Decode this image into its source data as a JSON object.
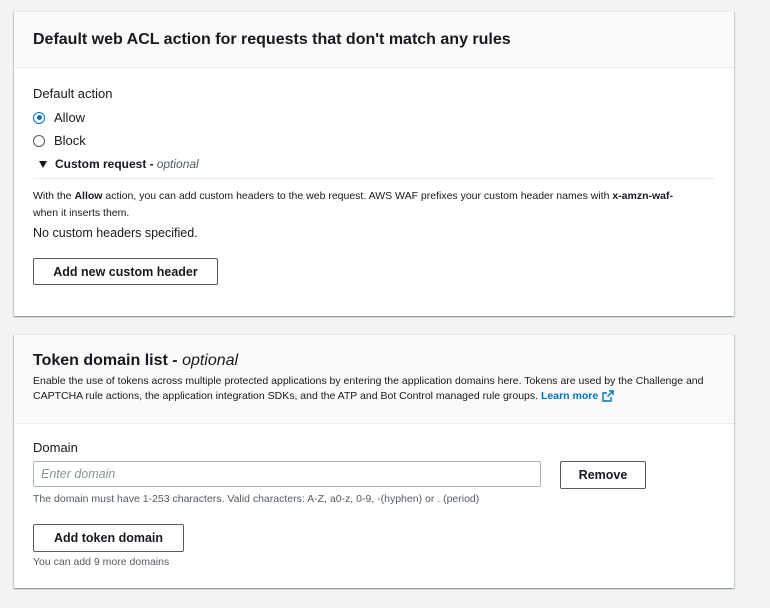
{
  "default_action_section": {
    "title": "Default web ACL action for requests that don't match any rules",
    "field_label": "Default action",
    "options": [
      {
        "label": "Allow",
        "checked": true
      },
      {
        "label": "Block",
        "checked": false
      }
    ],
    "custom_request": {
      "label": "Custom request -",
      "optional": "optional",
      "desc_prefix": "With the ",
      "desc_bold": "Allow",
      "desc_middle": " action, you can add custom headers to the web request. AWS WAF prefixes your custom header names with ",
      "desc_code": "x-amzn-waf-",
      "desc_suffix": "when it inserts them.",
      "empty_text": "No custom headers specified.",
      "add_button": "Add new custom header"
    }
  },
  "token_domain_section": {
    "title": "Token domain list -",
    "optional": "optional",
    "description": "Enable the use of tokens across multiple protected applications by entering the application domains here. Tokens are used by the Challenge and CAPTCHA rule actions, the application integration SDKs, and the ATP and Bot Control managed rule groups.",
    "learn_more": "Learn more",
    "domain_label": "Domain",
    "domain_placeholder": "Enter domain",
    "domain_value": "",
    "remove_button": "Remove",
    "constraint_text": "The domain must have 1-253 characters. Valid characters: A-Z, a0-z, 0-9, -(hyphen) or . (period)",
    "add_button": "Add token domain",
    "remaining_text": "You can add 9 more domains"
  },
  "colors": {
    "background": "#f2f3f3",
    "accent": "#0073bb",
    "text": "#16191f",
    "muted": "#545b64"
  }
}
